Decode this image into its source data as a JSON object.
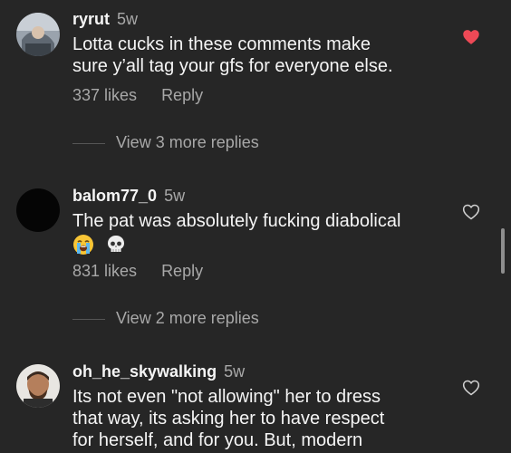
{
  "colors": {
    "background": "#262626",
    "text_primary": "#f5f5f5",
    "text_secondary": "#a8a8a8",
    "heart_liked": "#ed4956"
  },
  "comments": [
    {
      "username": "ryrut",
      "time": "5w",
      "lines": [
        "Lotta cucks in these comments make",
        "sure y’all tag your gfs for everyone else."
      ],
      "likes": "337 likes",
      "reply": "Reply",
      "liked": true,
      "heart_icon": "heart-filled-icon",
      "view_replies": "View 3 more replies"
    },
    {
      "username": "balom77_0",
      "time": "5w",
      "lines": [
        "The pat was absolutely fucking diabolical"
      ],
      "emojis": [
        "loudly-crying-face-icon",
        "skull-icon"
      ],
      "likes": "831 likes",
      "reply": "Reply",
      "liked": false,
      "heart_icon": "heart-outline-icon",
      "view_replies": "View 2 more replies"
    },
    {
      "username": "oh_he_skywalking",
      "time": "5w",
      "lines": [
        "Its not even \"not allowing\" her to dress",
        "that way, its asking her to have respect",
        "for herself, and for you. But, modern"
      ],
      "liked": false,
      "heart_icon": "heart-outline-icon"
    }
  ]
}
